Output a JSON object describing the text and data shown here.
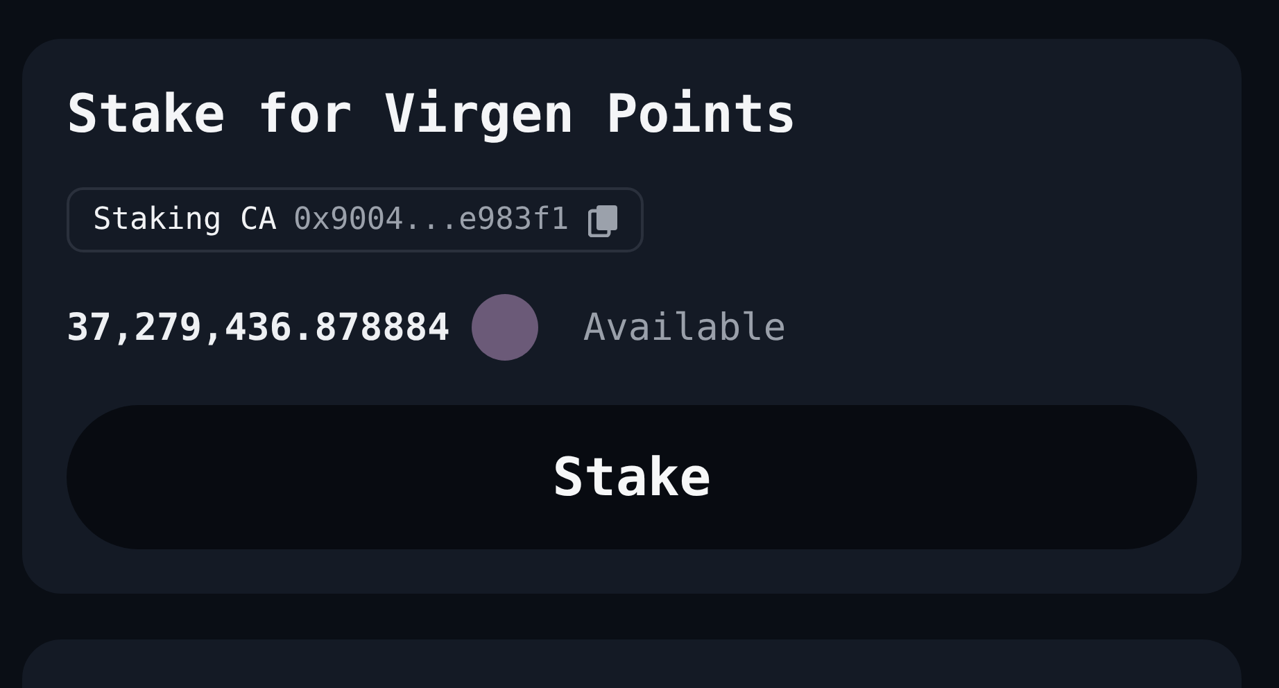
{
  "stake_card": {
    "title": "Stake for Virgen Points",
    "contract": {
      "label": "Staking CA",
      "address": "0x9004...e983f1"
    },
    "balance": {
      "amount": "37,279,436.878884",
      "status": "Available"
    },
    "button": "Stake"
  }
}
